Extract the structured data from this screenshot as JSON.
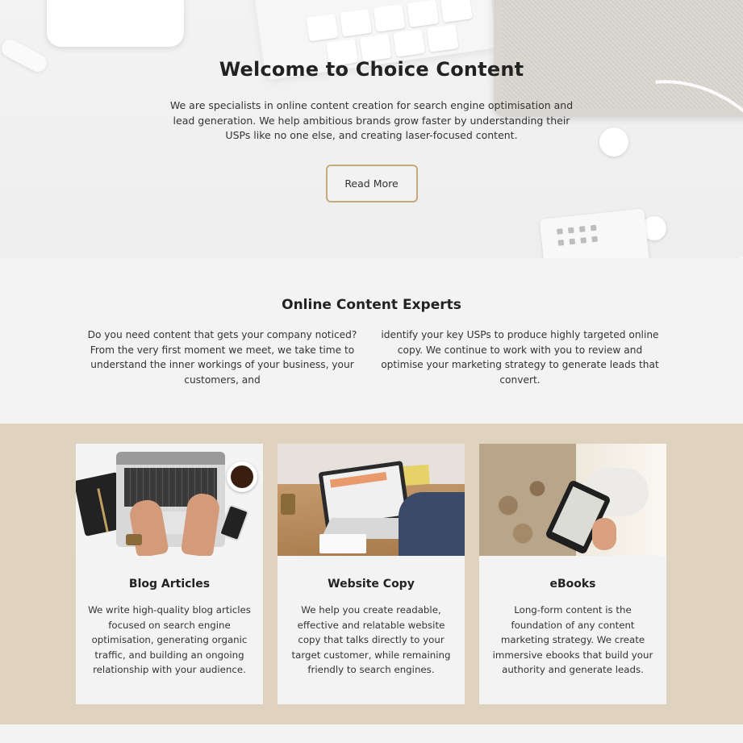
{
  "hero": {
    "title": "Welcome to Choice Content",
    "description": "We are specialists in online content creation for search engine optimisation and lead generation. We help ambitious brands grow faster by understanding their USPs like no one else, and creating laser-focused content.",
    "button_label": "Read More"
  },
  "experts": {
    "title": "Online Content Experts",
    "col1": "Do you need content that gets your company noticed? From the very first moment we meet, we take time to understand the inner workings of your business, your customers, and",
    "col2": "identify your key USPs to produce highly targeted online copy. We continue to work with you to review and optimise your marketing strategy to generate leads that convert."
  },
  "services": [
    {
      "title": "Blog Articles",
      "description": "We write high-quality blog articles focused on search engine optimisation, generating organic traffic, and building an ongoing relationship with your audience.",
      "image": "laptop-typing-photo"
    },
    {
      "title": "Website Copy",
      "description": "We help you create readable, effective and relatable website copy that talks directly to your target customer, while remaining friendly to search engines.",
      "image": "desk-laptop-photo"
    },
    {
      "title": "eBooks",
      "description": "Long-form content is the foundation of any content marketing strategy. We create immersive ebooks that build your authority and generate leads.",
      "image": "tablet-reading-photo"
    }
  ],
  "colors": {
    "accent_gold": "#c4aa7c",
    "services_bg": "#dfd2bf",
    "page_bg": "#f3f3f3"
  }
}
